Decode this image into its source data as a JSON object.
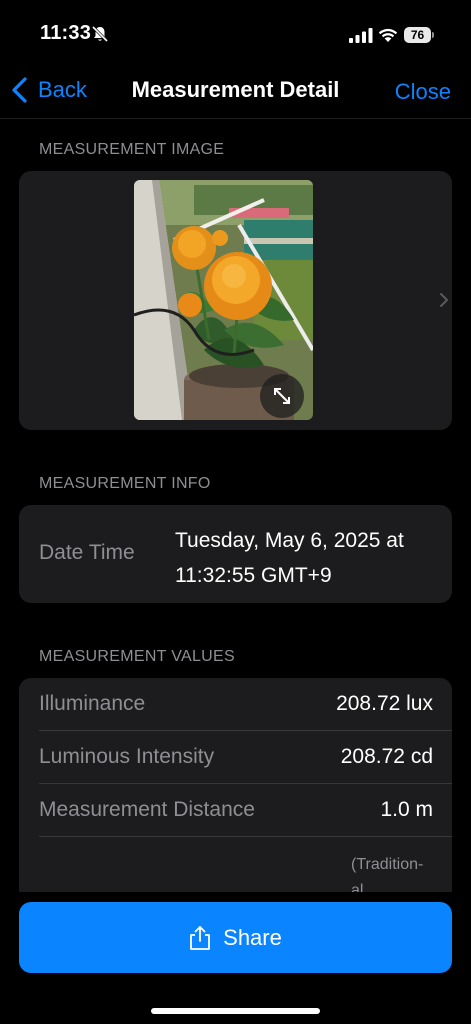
{
  "status_bar": {
    "time": "11:33",
    "battery_level": "76",
    "icons": [
      "bell-slash-icon",
      "signal-icon",
      "wifi-icon",
      "battery-icon"
    ]
  },
  "nav": {
    "back_label": "Back",
    "title": "Measurement Detail",
    "close_label": "Close",
    "accent_color": "#0a84ff"
  },
  "sections": {
    "image_header": "MEASUREMENT IMAGE",
    "info_header": "MEASUREMENT INFO",
    "values_header": "MEASUREMENT VALUES"
  },
  "image": {
    "expand_icon": "expand-arrows-icon",
    "next_icon": "chevron-right-icon"
  },
  "info": {
    "date_time_label": "Date Time",
    "date_time_value": "Tuesday, May 6, 2025 at 11:32:55 GMT+9"
  },
  "values": [
    {
      "label": "Illuminance",
      "value": "208.72 lux"
    },
    {
      "label": "Luminous Intensity",
      "value": "208.72 cd"
    },
    {
      "label": "Measurement Distance",
      "value": "1.0 m"
    }
  ],
  "partial_note": "(Tradition-\nal",
  "share": {
    "label": "Share",
    "icon": "share-icon",
    "color": "#0a84ff"
  }
}
